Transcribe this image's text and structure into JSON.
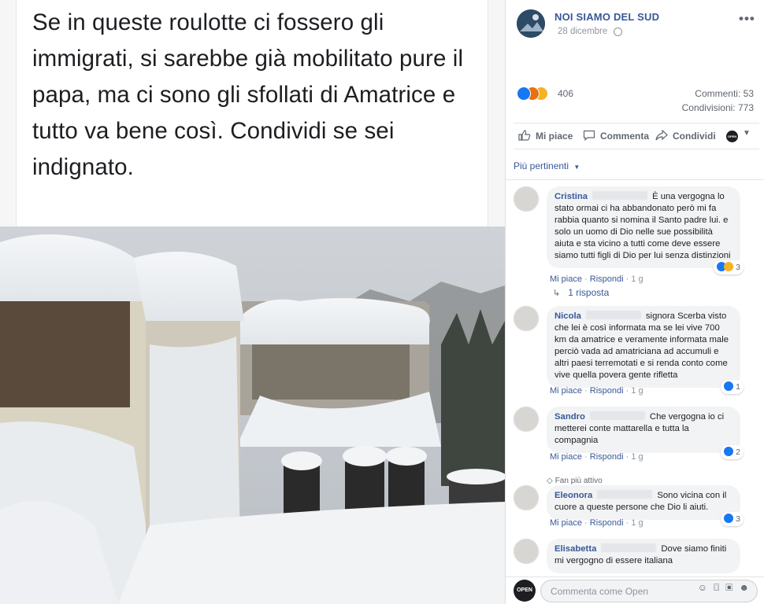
{
  "post": {
    "quote_text": "Se in queste roulotte ci fossero gli immigrati, si sarebbe già mobilitato pure il papa, ma ci sono gli sfollati di Amatrice e tutto va bene così. Condividi se sei indignato."
  },
  "sidebar": {
    "page_name": "NOI SIAMO DEL SUD",
    "date": "28 dicembre",
    "more": "•••",
    "reactions_count": "406",
    "comments_count": "Commenti: 53",
    "shares_count": "Condivisioni: 773",
    "actions": {
      "like": "Mi piace",
      "comment": "Commenta",
      "share": "Condividi",
      "open_badge": "OPEN"
    },
    "sort_label": "Più pertinenti",
    "comments": [
      {
        "name": "Cristina",
        "text": "È una vergogna lo stato ormai ci ha abbandonato però mi fa rabbia quanto si nomina il Santo padre lui. e solo un uomo di Dio nelle sue possibilità aiuta e sta vicino a tutti come deve essere siamo tutti figli di Dio per lui senza distinzioni",
        "reactions": "3",
        "like": "Mi piace",
        "reply": "Rispondi",
        "time": "1 g",
        "replies": "1 risposta"
      },
      {
        "name": "Nicola",
        "text": "signora Scerba visto che lei è così informata ma se lei vive 700 km da amatrice e veramente informata male perciò vada ad amatriciana ad accumuli e altri paesi terremotati e si renda conto come vive quella povera gente rifletta",
        "reactions": "1",
        "like": "Mi piace",
        "reply": "Rispondi",
        "time": "1 g"
      },
      {
        "name": "Sandro",
        "text": "Che vergogna io ci metterei conte mattarella e tutta la compagnia",
        "reactions": "2",
        "like": "Mi piace",
        "reply": "Rispondi",
        "time": "1 g"
      },
      {
        "badge": "Fan più attivo",
        "name": "Eleonora",
        "text": "Sono vicina con il cuore a queste persone che Dio li aiuti.",
        "reactions": "3",
        "like": "Mi piace",
        "reply": "Rispondi",
        "time": "1 g"
      },
      {
        "name": "Elisabetta",
        "text": "Dove siamo finiti mi vergogno di essere italiana"
      }
    ],
    "compose_placeholder": "Commenta come Open",
    "compose_avatar": "OPEN"
  },
  "colors": {
    "link": "#385898",
    "like_blue": "#1877f2",
    "angry": "#e9710f",
    "sad": "#f7b125"
  }
}
